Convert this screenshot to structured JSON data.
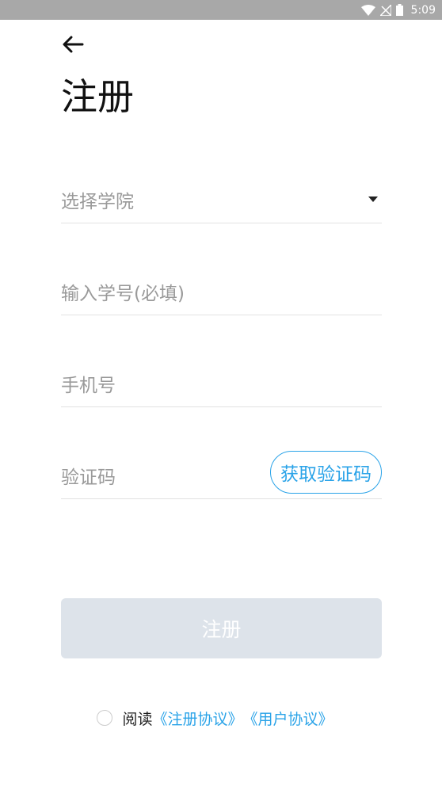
{
  "status_bar": {
    "time": "5:09",
    "icons": [
      "wifi-icon",
      "no-signal-icon",
      "battery-icon"
    ]
  },
  "header": {
    "back_icon": "arrow-left-icon",
    "title": "注册"
  },
  "form": {
    "school": {
      "placeholder": "选择学院",
      "icon": "dropdown-arrow-icon"
    },
    "student_id": {
      "placeholder": "输入学号(必填)"
    },
    "phone": {
      "placeholder": "手机号"
    },
    "code": {
      "placeholder": "验证码",
      "button_label": "获取验证码"
    }
  },
  "register_button": {
    "label": "注册"
  },
  "agreement": {
    "prefix": "阅读",
    "register_agreement": "《注册协议》",
    "user_agreement": "《用户协议》"
  },
  "colors": {
    "accent": "#2aa3e8",
    "disabled_button": "#dde3ea",
    "status_bar": "#a8a8a8"
  }
}
